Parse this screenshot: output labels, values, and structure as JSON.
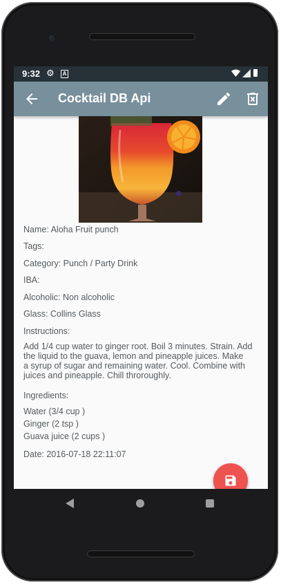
{
  "status_bar": {
    "time": "9:32"
  },
  "toolbar": {
    "title": "Cocktail DB Api"
  },
  "drink": {
    "name": "Name: Aloha Fruit punch",
    "tags": "Tags:",
    "category": "Category: Punch / Party Drink",
    "iba": "IBA:",
    "alcoholic": "Alcoholic: Non alcoholic",
    "glass": "Glass: Collins Glass",
    "instructions_label": "Instructions:",
    "instructions_lines": [
      "Add 1/4 cup water to ginger root. Boil 3 minutes. Strain. Add",
      "the liquid to the guava, lemon and pineapple juices. Make",
      "a syrup of sugar and remaining water. Cool. Combine with",
      "juices and pineapple. Chill throroughly."
    ],
    "ingredients_label": "Ingredients:",
    "ingredients": [
      "Water (3/4 cup )",
      "Ginger (2 tsp )",
      "Guava juice (2 cups )"
    ],
    "date": "Date: 2016-07-18 22:11:07"
  },
  "icons": {
    "back": "arrow-back-icon",
    "edit": "pencil-icon",
    "delete": "delete-icon",
    "save": "save-icon"
  },
  "colors": {
    "toolbar": "#78909c",
    "status_bar": "#263238",
    "fab": "#ef5350"
  }
}
